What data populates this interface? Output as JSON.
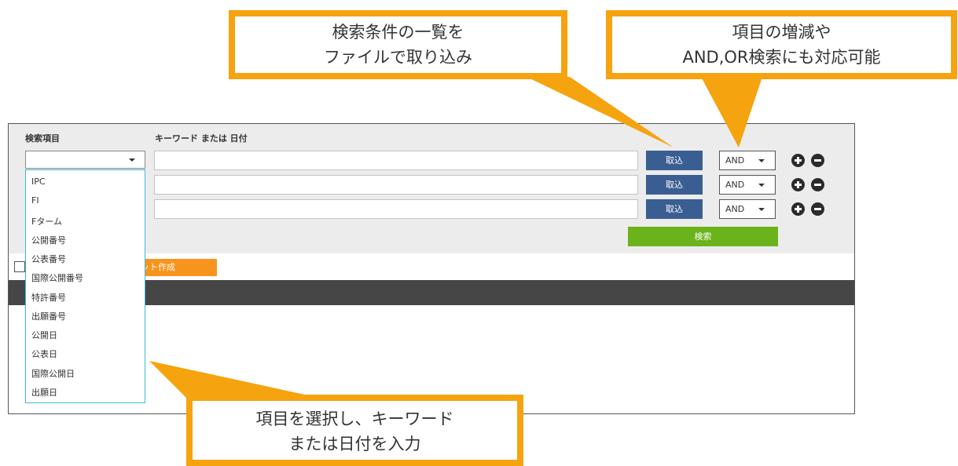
{
  "search_form": {
    "field_header": "検索項目",
    "keyword_header": "キーワード または 日付",
    "field_select_value": "",
    "rows": [
      {
        "keyword": "",
        "import_label": "取込",
        "operator": "AND"
      },
      {
        "keyword": "",
        "import_label": "取込",
        "operator": "AND"
      },
      {
        "keyword": "",
        "import_label": "取込",
        "operator": "AND"
      }
    ],
    "search_label": "検索"
  },
  "dropdown_options": [
    "IPC",
    "FI",
    "Fターム",
    "公開番号",
    "公表番号",
    "国際公開番号",
    "特許番号",
    "出願番号",
    "公開日",
    "公表日",
    "国際公開日",
    "出願日"
  ],
  "results": {
    "set_button_label": "ット作成"
  },
  "callouts": {
    "file_import": {
      "line1": "検索条件の一覧を",
      "line2": "ファイルで取り込み"
    },
    "operators": {
      "line1": "項目の増減や",
      "line2": "AND,OR検索にも対応可能"
    },
    "select_field": {
      "line1": "項目を選択し、キーワード",
      "line2": "または日付を入力"
    }
  },
  "colors": {
    "callout_border": "#f5a30f",
    "import_button": "#3a5e92",
    "search_button": "#6ab31a",
    "set_button": "#f7941d",
    "dropdown_border": "#3cb9d6"
  }
}
